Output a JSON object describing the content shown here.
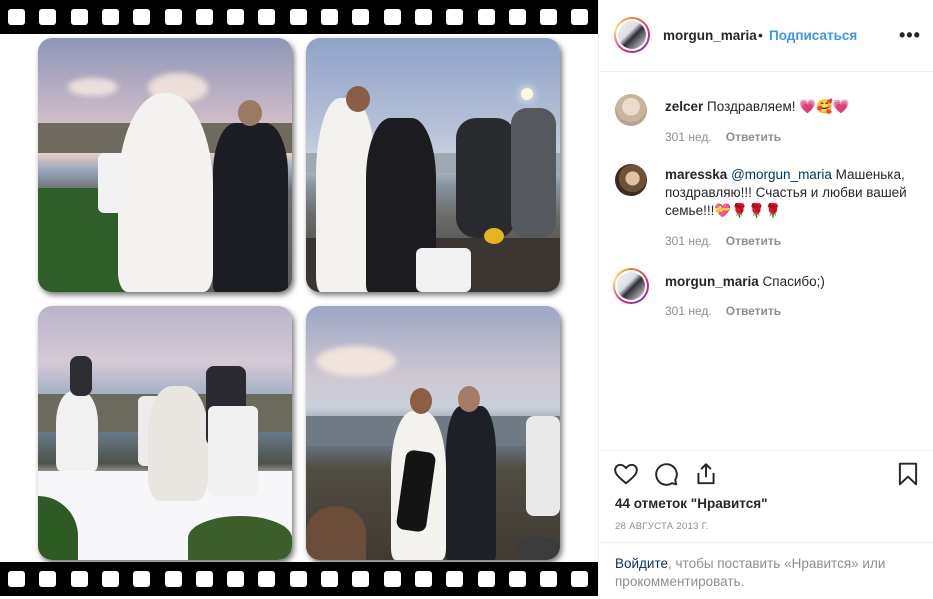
{
  "post": {
    "author": {
      "username": "morgun_maria",
      "separator": "•",
      "follow_label": "Подписаться",
      "more_label": "•••"
    },
    "comments": [
      {
        "username": "zelcer",
        "text": "Поздравляем! 💗🥰💗",
        "age": "301 нед.",
        "reply_label": "Ответить",
        "avatar": "avatar-zelcer"
      },
      {
        "username": "maresska",
        "mention": "@morgun_maria",
        "text": " Машенька, поздравляю!!! Счастья и любви вашей семье!!!💝🌹🌹🌹",
        "age": "301 нед.",
        "reply_label": "Ответить",
        "avatar": "avatar-maresska"
      },
      {
        "username": "morgun_maria",
        "text": "Спасибо;)",
        "age": "301 нед.",
        "reply_label": "Ответить",
        "avatar": "avatar-morgun_maria"
      }
    ],
    "actions": {
      "icons": [
        "heart-icon",
        "comment-icon",
        "share-icon",
        "bookmark-icon"
      ],
      "likes_text": "44 отметок \"Нравится\"",
      "date_text": "28 августа 2013 г."
    },
    "login_prompt": {
      "link": "Войдите",
      "rest": ", чтобы поставить «Нравится» или прокомментировать."
    }
  },
  "media": {
    "photos": [
      "wedding-photo-walk",
      "wedding-photo-kiss",
      "wedding-photo-ceremony",
      "wedding-photo-couple"
    ]
  },
  "colors": {
    "accent": "#3897f0",
    "text": "#262626",
    "muted": "#8e8e8e",
    "link": "#003569",
    "film": "#000000"
  }
}
